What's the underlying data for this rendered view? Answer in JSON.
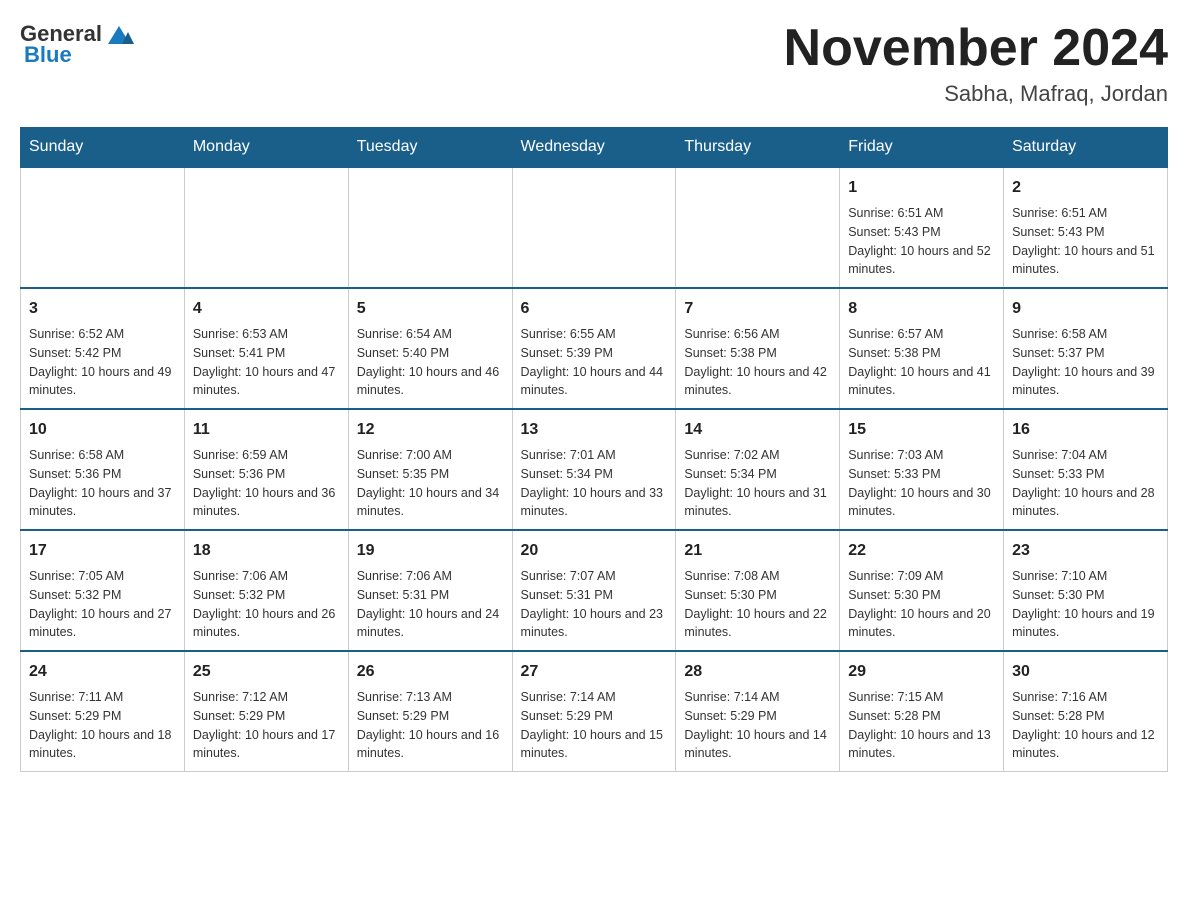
{
  "header": {
    "logo_general": "General",
    "logo_blue": "Blue",
    "month_title": "November 2024",
    "location": "Sabha, Mafraq, Jordan"
  },
  "days_of_week": [
    "Sunday",
    "Monday",
    "Tuesday",
    "Wednesday",
    "Thursday",
    "Friday",
    "Saturday"
  ],
  "weeks": [
    [
      {
        "day": "",
        "info": ""
      },
      {
        "day": "",
        "info": ""
      },
      {
        "day": "",
        "info": ""
      },
      {
        "day": "",
        "info": ""
      },
      {
        "day": "",
        "info": ""
      },
      {
        "day": "1",
        "info": "Sunrise: 6:51 AM\nSunset: 5:43 PM\nDaylight: 10 hours and 52 minutes."
      },
      {
        "day": "2",
        "info": "Sunrise: 6:51 AM\nSunset: 5:43 PM\nDaylight: 10 hours and 51 minutes."
      }
    ],
    [
      {
        "day": "3",
        "info": "Sunrise: 6:52 AM\nSunset: 5:42 PM\nDaylight: 10 hours and 49 minutes."
      },
      {
        "day": "4",
        "info": "Sunrise: 6:53 AM\nSunset: 5:41 PM\nDaylight: 10 hours and 47 minutes."
      },
      {
        "day": "5",
        "info": "Sunrise: 6:54 AM\nSunset: 5:40 PM\nDaylight: 10 hours and 46 minutes."
      },
      {
        "day": "6",
        "info": "Sunrise: 6:55 AM\nSunset: 5:39 PM\nDaylight: 10 hours and 44 minutes."
      },
      {
        "day": "7",
        "info": "Sunrise: 6:56 AM\nSunset: 5:38 PM\nDaylight: 10 hours and 42 minutes."
      },
      {
        "day": "8",
        "info": "Sunrise: 6:57 AM\nSunset: 5:38 PM\nDaylight: 10 hours and 41 minutes."
      },
      {
        "day": "9",
        "info": "Sunrise: 6:58 AM\nSunset: 5:37 PM\nDaylight: 10 hours and 39 minutes."
      }
    ],
    [
      {
        "day": "10",
        "info": "Sunrise: 6:58 AM\nSunset: 5:36 PM\nDaylight: 10 hours and 37 minutes."
      },
      {
        "day": "11",
        "info": "Sunrise: 6:59 AM\nSunset: 5:36 PM\nDaylight: 10 hours and 36 minutes."
      },
      {
        "day": "12",
        "info": "Sunrise: 7:00 AM\nSunset: 5:35 PM\nDaylight: 10 hours and 34 minutes."
      },
      {
        "day": "13",
        "info": "Sunrise: 7:01 AM\nSunset: 5:34 PM\nDaylight: 10 hours and 33 minutes."
      },
      {
        "day": "14",
        "info": "Sunrise: 7:02 AM\nSunset: 5:34 PM\nDaylight: 10 hours and 31 minutes."
      },
      {
        "day": "15",
        "info": "Sunrise: 7:03 AM\nSunset: 5:33 PM\nDaylight: 10 hours and 30 minutes."
      },
      {
        "day": "16",
        "info": "Sunrise: 7:04 AM\nSunset: 5:33 PM\nDaylight: 10 hours and 28 minutes."
      }
    ],
    [
      {
        "day": "17",
        "info": "Sunrise: 7:05 AM\nSunset: 5:32 PM\nDaylight: 10 hours and 27 minutes."
      },
      {
        "day": "18",
        "info": "Sunrise: 7:06 AM\nSunset: 5:32 PM\nDaylight: 10 hours and 26 minutes."
      },
      {
        "day": "19",
        "info": "Sunrise: 7:06 AM\nSunset: 5:31 PM\nDaylight: 10 hours and 24 minutes."
      },
      {
        "day": "20",
        "info": "Sunrise: 7:07 AM\nSunset: 5:31 PM\nDaylight: 10 hours and 23 minutes."
      },
      {
        "day": "21",
        "info": "Sunrise: 7:08 AM\nSunset: 5:30 PM\nDaylight: 10 hours and 22 minutes."
      },
      {
        "day": "22",
        "info": "Sunrise: 7:09 AM\nSunset: 5:30 PM\nDaylight: 10 hours and 20 minutes."
      },
      {
        "day": "23",
        "info": "Sunrise: 7:10 AM\nSunset: 5:30 PM\nDaylight: 10 hours and 19 minutes."
      }
    ],
    [
      {
        "day": "24",
        "info": "Sunrise: 7:11 AM\nSunset: 5:29 PM\nDaylight: 10 hours and 18 minutes."
      },
      {
        "day": "25",
        "info": "Sunrise: 7:12 AM\nSunset: 5:29 PM\nDaylight: 10 hours and 17 minutes."
      },
      {
        "day": "26",
        "info": "Sunrise: 7:13 AM\nSunset: 5:29 PM\nDaylight: 10 hours and 16 minutes."
      },
      {
        "day": "27",
        "info": "Sunrise: 7:14 AM\nSunset: 5:29 PM\nDaylight: 10 hours and 15 minutes."
      },
      {
        "day": "28",
        "info": "Sunrise: 7:14 AM\nSunset: 5:29 PM\nDaylight: 10 hours and 14 minutes."
      },
      {
        "day": "29",
        "info": "Sunrise: 7:15 AM\nSunset: 5:28 PM\nDaylight: 10 hours and 13 minutes."
      },
      {
        "day": "30",
        "info": "Sunrise: 7:16 AM\nSunset: 5:28 PM\nDaylight: 10 hours and 12 minutes."
      }
    ]
  ]
}
